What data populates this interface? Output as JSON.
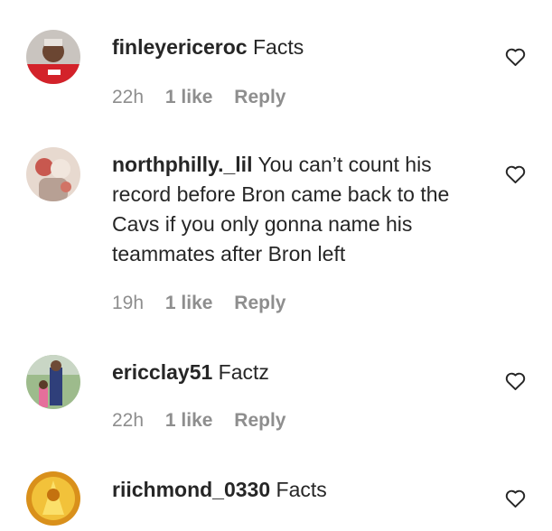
{
  "comments": [
    {
      "username": "finleyericeroc",
      "text": "Facts",
      "time": "22h",
      "likes": "1 like",
      "reply": "Reply",
      "avatar": "person-red-shirt"
    },
    {
      "username": "northphilly._lil",
      "text": "You can’t count his record before Bron came back to the Cavs if you only gonna name his teammates after Bron left",
      "time": "19h",
      "likes": "1 like",
      "reply": "Reply",
      "avatar": "baby-photo"
    },
    {
      "username": "ericclay51",
      "text": "Factz",
      "time": "22h",
      "likes": "1 like",
      "reply": "Reply",
      "avatar": "family-photo"
    },
    {
      "username": "riichmond_0330",
      "text": "Facts",
      "avatar": "gold-figure"
    }
  ],
  "colors": {
    "text": "#262626",
    "muted": "#8e8e8e"
  },
  "icons": {
    "like": "heart-outline-icon"
  }
}
